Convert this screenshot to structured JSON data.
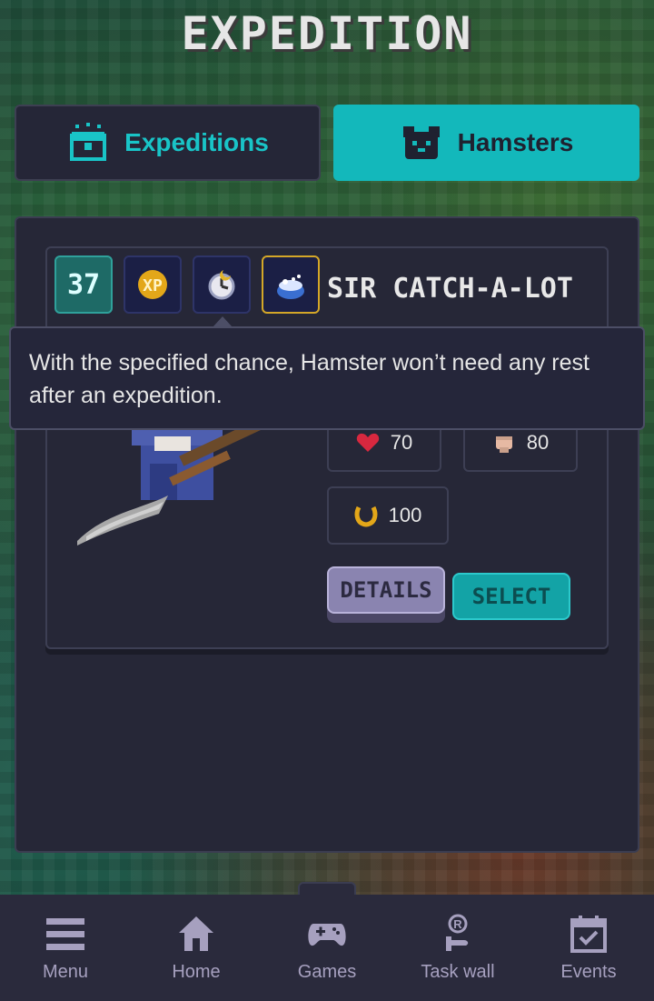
{
  "header": {
    "title": "EXPEDITION"
  },
  "tabs": [
    {
      "label": "Expeditions",
      "icon": "chest-icon",
      "active": false
    },
    {
      "label": "Hamsters",
      "icon": "hamster-face-icon",
      "active": true
    }
  ],
  "hamster_card": {
    "level": "37",
    "badges": [
      "xp-boost-icon",
      "clock-icon",
      "item-pot-icon"
    ],
    "name": "SIR CATCH-A-LOT",
    "tooltip": "With the specified chance, Hamster won’t need any rest after an expedition.",
    "stats": {
      "health": {
        "icon": "heart-icon",
        "value": "70"
      },
      "strength": {
        "icon": "fist-icon",
        "value": "80"
      },
      "luck": {
        "icon": "horseshoe-icon",
        "value": "100"
      }
    },
    "details_label": "DETAILS",
    "select_label": "SELECT"
  },
  "bottom_nav": [
    {
      "label": "Menu",
      "icon": "menu-icon"
    },
    {
      "label": "Home",
      "icon": "home-icon"
    },
    {
      "label": "Games",
      "icon": "gamepad-icon"
    },
    {
      "label": "Task wall",
      "icon": "task-icon"
    },
    {
      "label": "Events",
      "icon": "calendar-icon"
    }
  ],
  "colors": {
    "accent": "#13b8bb",
    "panel": "#262737",
    "nav": "#2a2a3c"
  }
}
